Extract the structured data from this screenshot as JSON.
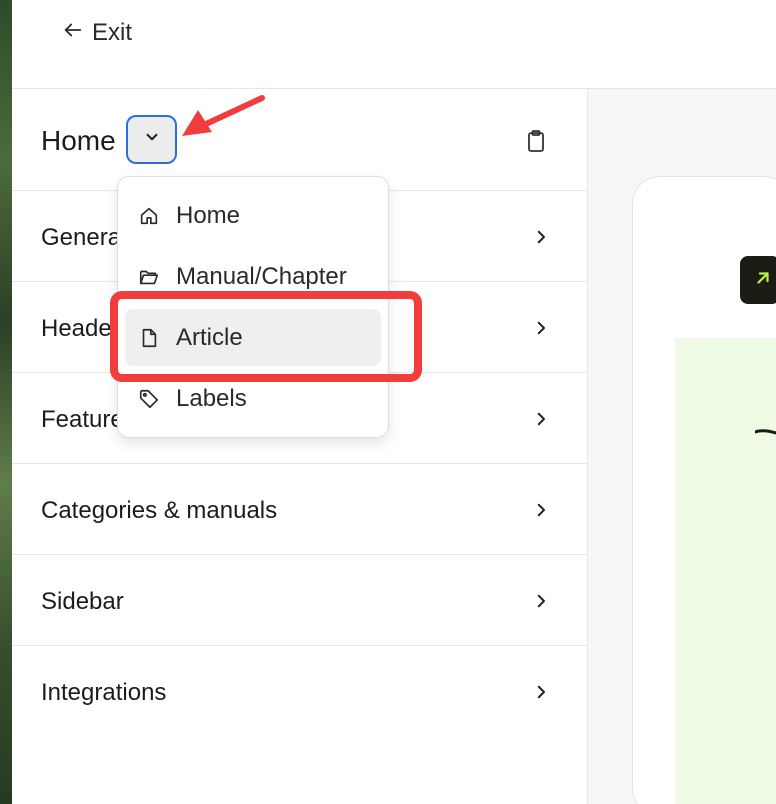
{
  "topbar": {
    "exit_label": "Exit",
    "exit_icon": "arrow-left-icon"
  },
  "panel": {
    "title": "Home",
    "toggle_icon": "chevron-down-icon",
    "clipboard_icon": "clipboard-icon",
    "sections": [
      {
        "label": "General"
      },
      {
        "label": "Header"
      },
      {
        "label": "Featured"
      },
      {
        "label": "Categories & manuals"
      },
      {
        "label": "Sidebar"
      },
      {
        "label": "Integrations"
      }
    ]
  },
  "dropdown": {
    "items": [
      {
        "label": "Home",
        "icon": "home-icon"
      },
      {
        "label": "Manual/Chapter",
        "icon": "folder-open-icon"
      },
      {
        "label": "Article",
        "icon": "file-icon",
        "hovered": true
      },
      {
        "label": "Labels",
        "icon": "tag-icon"
      }
    ]
  },
  "colors": {
    "annotation": "#f23d3d",
    "toggle_border": "#2c6fdc",
    "preview_body": "#effbe5",
    "preview_badge": "#1c1c14",
    "badge_arrow": "#b8f044"
  }
}
